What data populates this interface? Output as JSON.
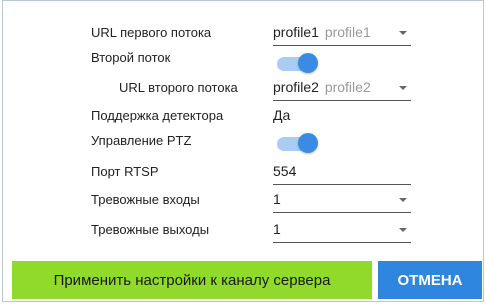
{
  "form": {
    "first_stream": {
      "label": "URL первого потока",
      "value": "profile1",
      "value_secondary": "profile1"
    },
    "second_stream": {
      "label": "Второй поток",
      "enabled": true
    },
    "second_stream_url": {
      "label": "URL второго потока",
      "value": "profile2",
      "value_secondary": "profile2"
    },
    "detector_support": {
      "label": "Поддержка детектора",
      "value": "Да"
    },
    "ptz_control": {
      "label": "Управление PTZ",
      "enabled": true
    },
    "rtsp_port": {
      "label": "Порт RTSP",
      "value": "554"
    },
    "alarm_inputs": {
      "label": "Тревожные входы",
      "value": "1"
    },
    "alarm_outputs": {
      "label": "Тревожные выходы",
      "value": "1"
    }
  },
  "buttons": {
    "apply_label": "Применить настройки к каналу сервера",
    "cancel_label": "ОТМЕНА"
  },
  "colors": {
    "toggle_on": "#3b8ae4",
    "apply_bg": "#8fda2a",
    "cancel_bg": "#2f86de"
  }
}
